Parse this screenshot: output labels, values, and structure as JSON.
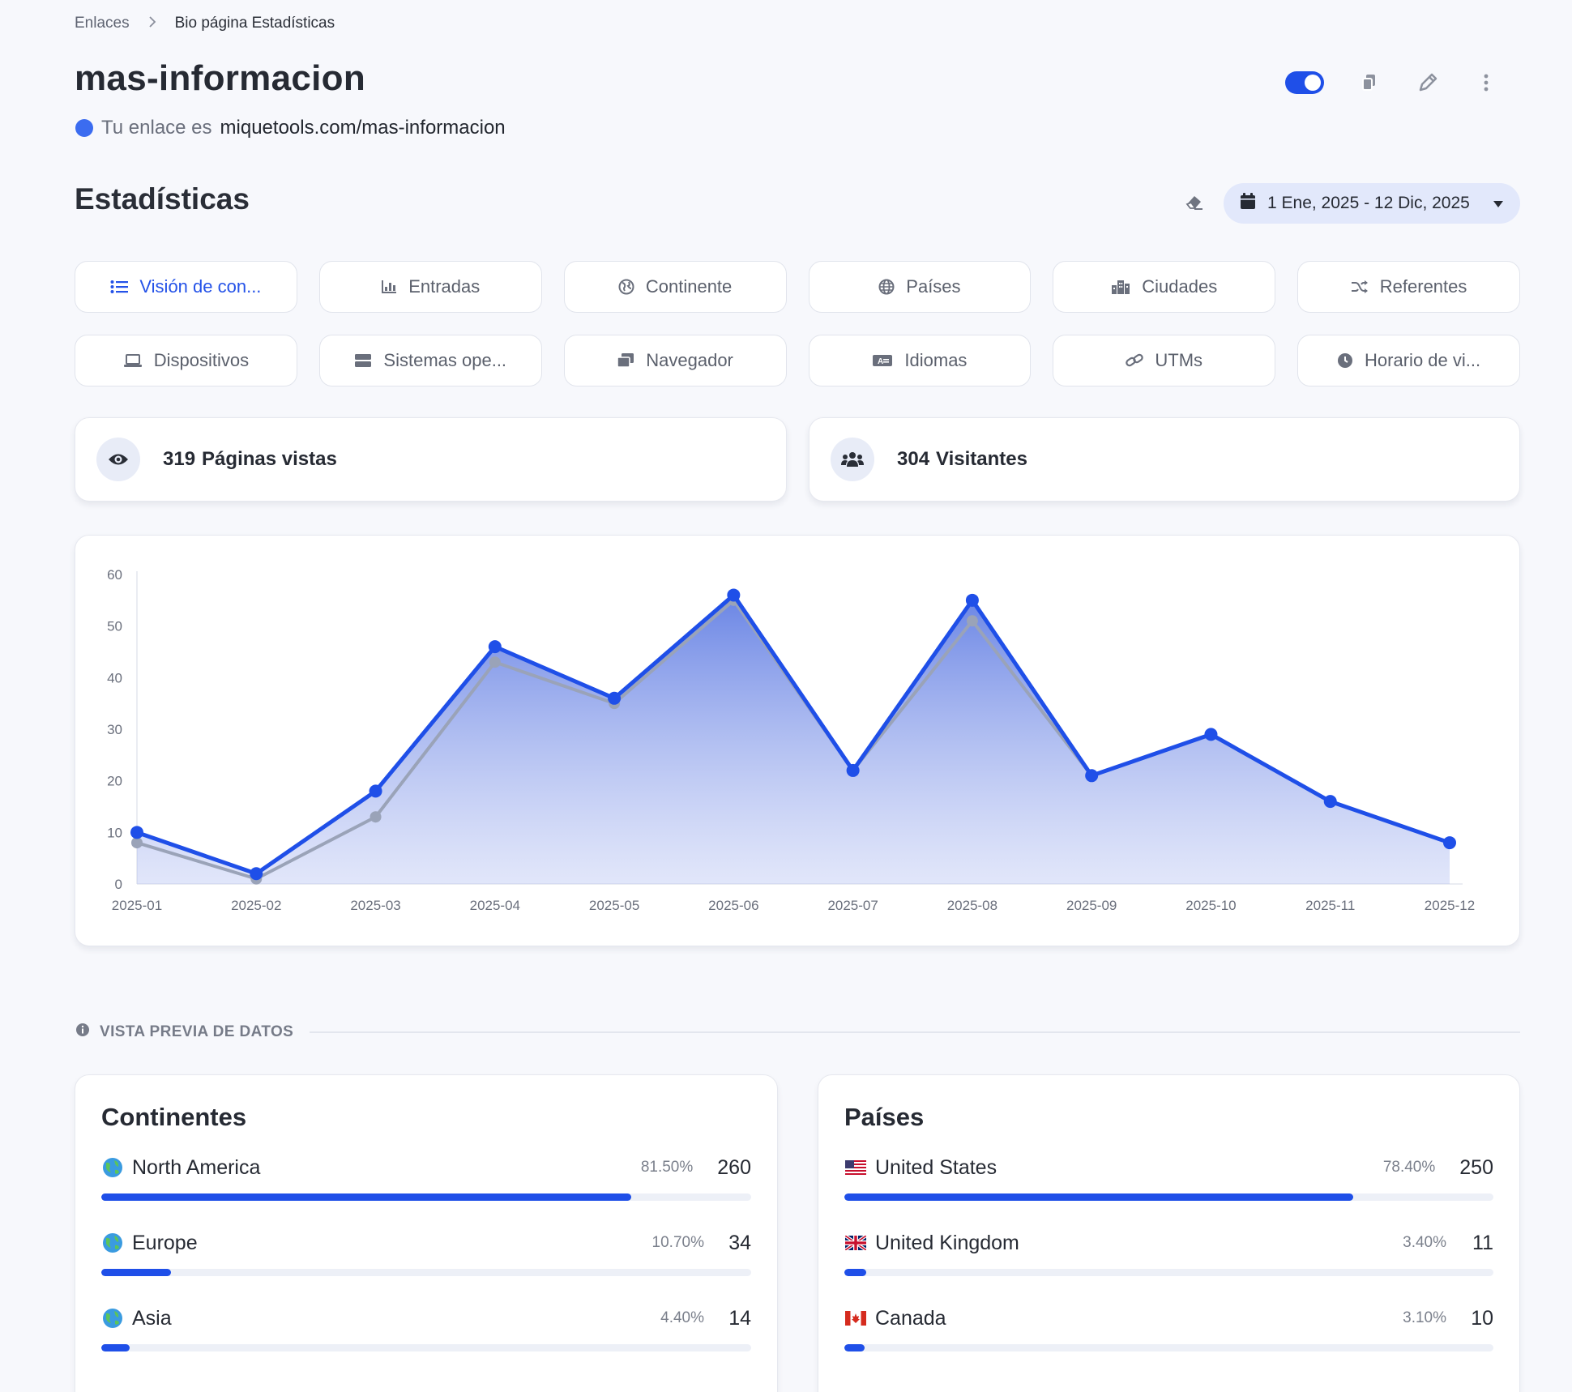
{
  "breadcrumb": {
    "root": "Enlaces",
    "current": "Bio página Estadísticas"
  },
  "page": {
    "title": "mas-informacion",
    "link_prefix": "Tu enlace es",
    "link_url": "miquetools.com/mas-informacion"
  },
  "stats": {
    "title": "Estadísticas",
    "date_range": "1 Ene, 2025 - 12 Dic, 2025"
  },
  "tabs": [
    {
      "label": "Visión de con...",
      "icon": "list-icon",
      "active": true
    },
    {
      "label": "Entradas",
      "icon": "chart-bars-icon"
    },
    {
      "label": "Continente",
      "icon": "globe-americas-icon"
    },
    {
      "label": "Países",
      "icon": "globe-icon"
    },
    {
      "label": "Ciudades",
      "icon": "city-icon"
    },
    {
      "label": "Referentes",
      "icon": "shuffle-icon"
    },
    {
      "label": "Dispositivos",
      "icon": "laptop-icon"
    },
    {
      "label": "Sistemas ope...",
      "icon": "server-icon"
    },
    {
      "label": "Navegador",
      "icon": "windows-icon"
    },
    {
      "label": "Idiomas",
      "icon": "language-icon"
    },
    {
      "label": "UTMs",
      "icon": "link-icon"
    },
    {
      "label": "Horario de vi...",
      "icon": "clock-icon"
    }
  ],
  "summary": {
    "pageviews_value": "319",
    "pageviews_label": "Páginas vistas",
    "visitors_value": "304",
    "visitors_label": "Visitantes"
  },
  "chart_data": {
    "type": "area",
    "x": [
      "2025-01",
      "2025-02",
      "2025-03",
      "2025-04",
      "2025-05",
      "2025-06",
      "2025-07",
      "2025-08",
      "2025-09",
      "2025-10",
      "2025-11",
      "2025-12"
    ],
    "series": [
      {
        "values": [
          10,
          2,
          18,
          46,
          36,
          56,
          22,
          55,
          21,
          29,
          16,
          8
        ],
        "color": "#1f4fe8"
      },
      {
        "values": [
          8,
          1,
          13,
          43,
          35,
          55,
          22,
          51,
          21,
          29,
          16,
          8
        ],
        "color": "#9aa3b8"
      }
    ],
    "ylim": [
      0,
      60
    ],
    "yticks": [
      0,
      10,
      20,
      30,
      40,
      50,
      60
    ],
    "grid": false
  },
  "preview": {
    "label": "VISTA PREVIA DE DATOS"
  },
  "continents": {
    "title": "Continentes",
    "rows": [
      {
        "name": "North America",
        "pct": "81.50%",
        "count": "260",
        "fraction": 0.815
      },
      {
        "name": "Europe",
        "pct": "10.70%",
        "count": "34",
        "fraction": 0.107
      },
      {
        "name": "Asia",
        "pct": "4.40%",
        "count": "14",
        "fraction": 0.044
      }
    ]
  },
  "countries": {
    "title": "Países",
    "rows": [
      {
        "name": "United States",
        "pct": "78.40%",
        "count": "250",
        "fraction": 0.784,
        "flag": "us-flag-icon"
      },
      {
        "name": "United Kingdom",
        "pct": "3.40%",
        "count": "11",
        "fraction": 0.034,
        "flag": "uk-flag-icon"
      },
      {
        "name": "Canada",
        "pct": "3.10%",
        "count": "10",
        "fraction": 0.031,
        "flag": "canada-flag-icon"
      }
    ]
  },
  "colors": {
    "accent": "#1f4fe8",
    "accent_light": "#e2e8fb"
  }
}
